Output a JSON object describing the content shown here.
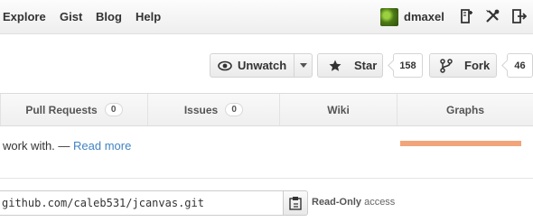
{
  "header": {
    "nav": [
      "Explore",
      "Gist",
      "Blog",
      "Help"
    ],
    "username": "dmaxel",
    "icons": [
      "new-repo-icon",
      "settings-icon",
      "sign-out-icon"
    ]
  },
  "repo_actions": {
    "unwatch_label": "Unwatch",
    "star_label": "Star",
    "star_count": "158",
    "fork_label": "Fork",
    "fork_count": "46"
  },
  "tabs": [
    {
      "label": "Pull Requests",
      "count": "0"
    },
    {
      "label": "Issues",
      "count": "0"
    },
    {
      "label": "Wiki"
    },
    {
      "label": "Graphs"
    }
  ],
  "description": {
    "text": "work with. — ",
    "link": "Read more"
  },
  "language_bar_color": "#f2a57a",
  "clone": {
    "url": "github.com/caleb531/jcanvas.git",
    "access_strong": "Read-Only",
    "access_rest": " access"
  }
}
